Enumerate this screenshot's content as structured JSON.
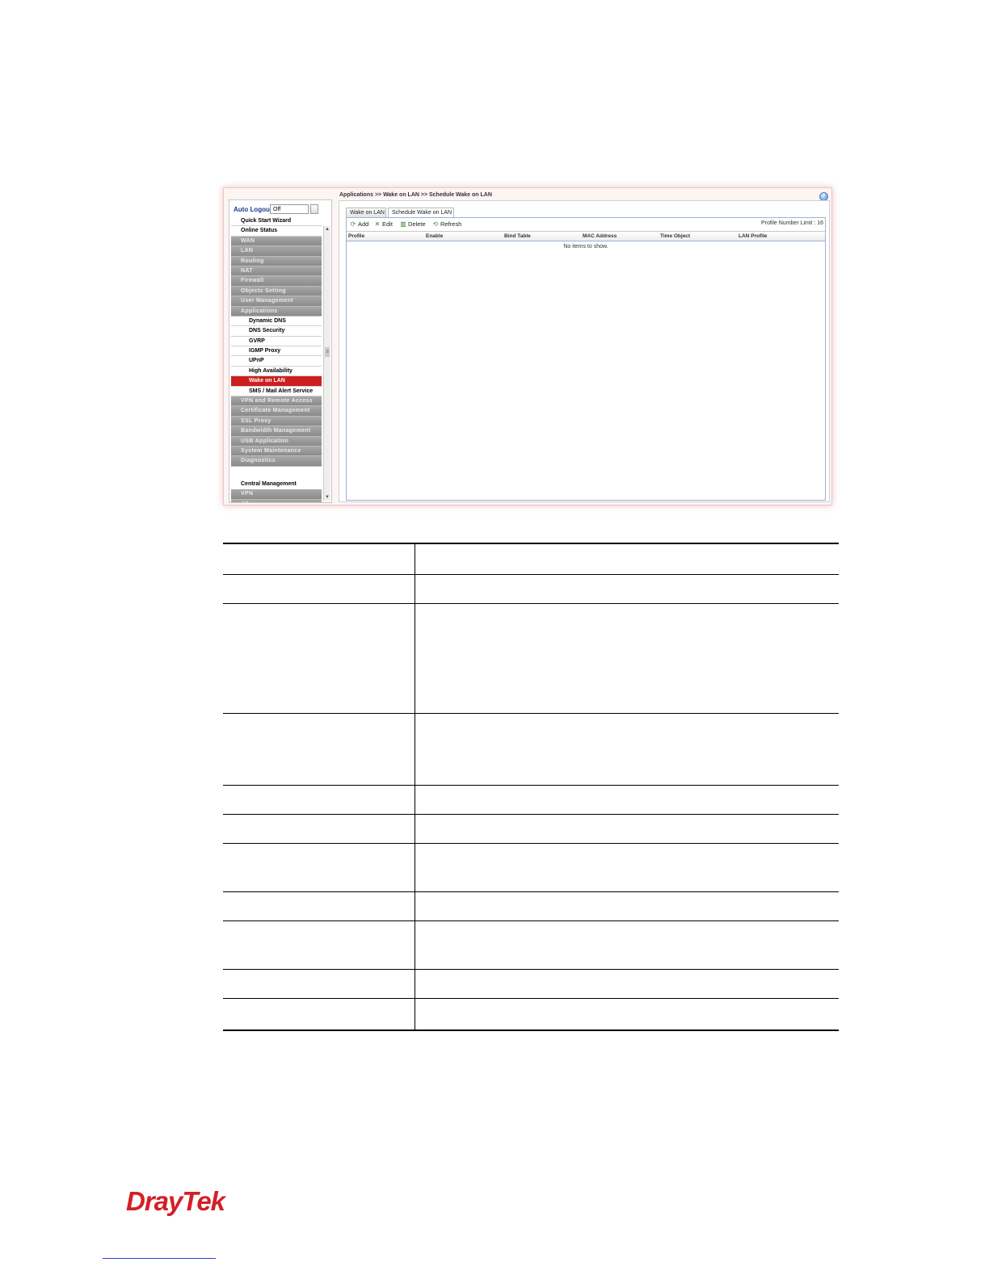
{
  "sidebar": {
    "auto_logout_label": "Auto Logout :",
    "auto_logout_value": "Off",
    "menu": [
      {
        "label": "Quick Start Wizard",
        "style": "white"
      },
      {
        "label": "Online Status",
        "style": "white"
      },
      {
        "label": "WAN",
        "style": "gray"
      },
      {
        "label": "LAN",
        "style": "gray"
      },
      {
        "label": "Routing",
        "style": "gray"
      },
      {
        "label": "NAT",
        "style": "gray"
      },
      {
        "label": "Firewall",
        "style": "gray"
      },
      {
        "label": "Objects Setting",
        "style": "gray"
      },
      {
        "label": "User Management",
        "style": "gray"
      },
      {
        "label": "Applications",
        "style": "gray"
      },
      {
        "label": "Dynamic DNS",
        "style": "sub"
      },
      {
        "label": "DNS Security",
        "style": "sub"
      },
      {
        "label": "GVRP",
        "style": "sub"
      },
      {
        "label": "IGMP Proxy",
        "style": "sub"
      },
      {
        "label": "UPnP",
        "style": "sub"
      },
      {
        "label": "High Availability",
        "style": "sub"
      },
      {
        "label": "Wake on LAN",
        "style": "active"
      },
      {
        "label": "SMS / Mail Alert Service",
        "style": "sub"
      },
      {
        "label": "VPN and Remote Access",
        "style": "gray"
      },
      {
        "label": "Certificate Management",
        "style": "gray"
      },
      {
        "label": "SSL Proxy",
        "style": "gray"
      },
      {
        "label": "Bandwidth Management",
        "style": "gray"
      },
      {
        "label": "USB Application",
        "style": "gray"
      },
      {
        "label": "System Maintenance",
        "style": "gray"
      },
      {
        "label": "Diagnostics",
        "style": "gray"
      },
      {
        "label": "",
        "style": "spacer"
      },
      {
        "label": "Central Management",
        "style": "head"
      },
      {
        "label": "VPN",
        "style": "gray"
      },
      {
        "label": "AP",
        "style": "gray"
      }
    ]
  },
  "main": {
    "breadcrumb": "Applications >> Wake on LAN >> Schedule Wake on LAN",
    "tabs": [
      "Wake on LAN",
      "Schedule Wake on LAN"
    ],
    "toolbar": {
      "add": "Add",
      "edit": "Edit",
      "delete": "Delete",
      "refresh": "Refresh"
    },
    "profile_limit": "Profile Number Limit : 16",
    "columns": [
      "Profile",
      "Enable",
      "Bind Table",
      "MAC Address",
      "Time Object",
      "LAN Profile"
    ],
    "empty_message": "No items to show."
  },
  "colors": {
    "active_menu": "#cc1f1f",
    "logo": "#d41f26"
  },
  "logo": {
    "text": "DrayTek"
  }
}
